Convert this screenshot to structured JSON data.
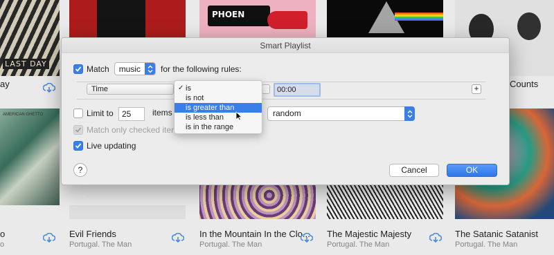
{
  "background": {
    "albums_top": [
      {
        "name": "album-art-last-day",
        "art_text": "LAST DAY"
      },
      {
        "name": "album-art-phoenix",
        "art_text": "PHOEN"
      }
    ],
    "row1_labels": {
      "left_partial": "ay",
      "right_partial": "Counts"
    },
    "art_caption": "AMERICAN GHETTO",
    "album_titles": [
      {
        "title": "o",
        "artist": "o"
      },
      {
        "title": "Evil Friends",
        "artist": "Portugal. The Man"
      },
      {
        "title": "In the Mountain In the Clo...",
        "artist": "Portugal. The Man"
      },
      {
        "title": "The Majestic Majesty",
        "artist": "Portugal. The Man"
      },
      {
        "title": "The Satanic Satanist",
        "artist": "Portugal. The Man"
      }
    ]
  },
  "dialog": {
    "title": "Smart Playlist",
    "match": {
      "checked": true,
      "label": "Match",
      "kind_value": "music",
      "suffix": "for the following rules:"
    },
    "rule": {
      "field": "Time",
      "value": "00:00"
    },
    "limit": {
      "checked": false,
      "label": "Limit to",
      "value": "25",
      "unit_partial": "items",
      "order_value": "random"
    },
    "match_checked": {
      "checked": true,
      "disabled": true,
      "label": "Match only checked item"
    },
    "live": {
      "checked": true,
      "label": "Live updating"
    },
    "help_label": "?",
    "cancel_label": "Cancel",
    "ok_label": "OK"
  },
  "menu": {
    "items": [
      "is",
      "is not",
      "is greater than",
      "is less than",
      "is in the range"
    ],
    "checked_index": 0,
    "highlighted_index": 2
  },
  "colors": {
    "accent": "#3a7ee8",
    "cloud": "#4a8fe0"
  }
}
